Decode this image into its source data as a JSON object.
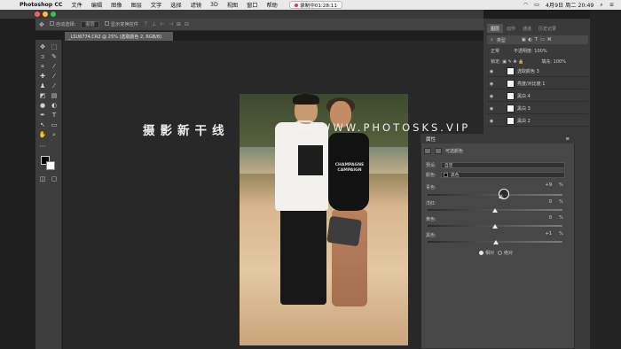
{
  "menubar": {
    "app_name": "Photoshop CC",
    "items": [
      "文件",
      "编辑",
      "图像",
      "图层",
      "文字",
      "选择",
      "滤镜",
      "3D",
      "视图",
      "窗口",
      "帮助"
    ],
    "recording_label": "录制中01:28:11",
    "date_time": "4月9日 周二 20:49"
  },
  "options_bar": {
    "auto_select_label": "自动选择:",
    "auto_select_value": "图层",
    "transform_controls_label": "显示变换控件"
  },
  "document_tab": "_LSU6774.CR2 @ 25% (选取颜色 2, RGB/8)",
  "watermark": {
    "left_text": "摄影新干线",
    "right_text": "WWW.PHOTOSKS.VIP"
  },
  "photo": {
    "shirt_text": "CHAMPAGNE CAMPAIGN"
  },
  "panels": {
    "tabs": [
      "图层",
      "动作",
      "通道",
      "历史记录"
    ],
    "filter_label": "类型",
    "blend_mode": "正常",
    "opacity_label": "不透明度:",
    "opacity_value": "100%",
    "lock_label": "锁定:",
    "fill_label": "填充:",
    "fill_value": "100%",
    "layers": [
      {
        "name": "选取颜色 3"
      },
      {
        "name": "亮度/对比度 1"
      },
      {
        "name": "黑白 4"
      },
      {
        "name": "黑白 3"
      },
      {
        "name": "黑白 2"
      }
    ]
  },
  "properties": {
    "title": "属性",
    "subtitle": "可选颜色",
    "preset_label": "预设:",
    "preset_value": "自定",
    "colors_label": "颜色:",
    "colors_value": "黑色",
    "sliders": [
      {
        "label": "青色:",
        "value": "+9",
        "unit": "%",
        "position": 0.545
      },
      {
        "label": "洋红:",
        "value": "0",
        "unit": "%",
        "position": 0.5
      },
      {
        "label": "黄色:",
        "value": "0",
        "unit": "%",
        "position": 0.5
      },
      {
        "label": "黑色:",
        "value": "+1",
        "unit": "%",
        "position": 0.505
      }
    ],
    "method_relative": "相对",
    "method_absolute": "绝对"
  }
}
